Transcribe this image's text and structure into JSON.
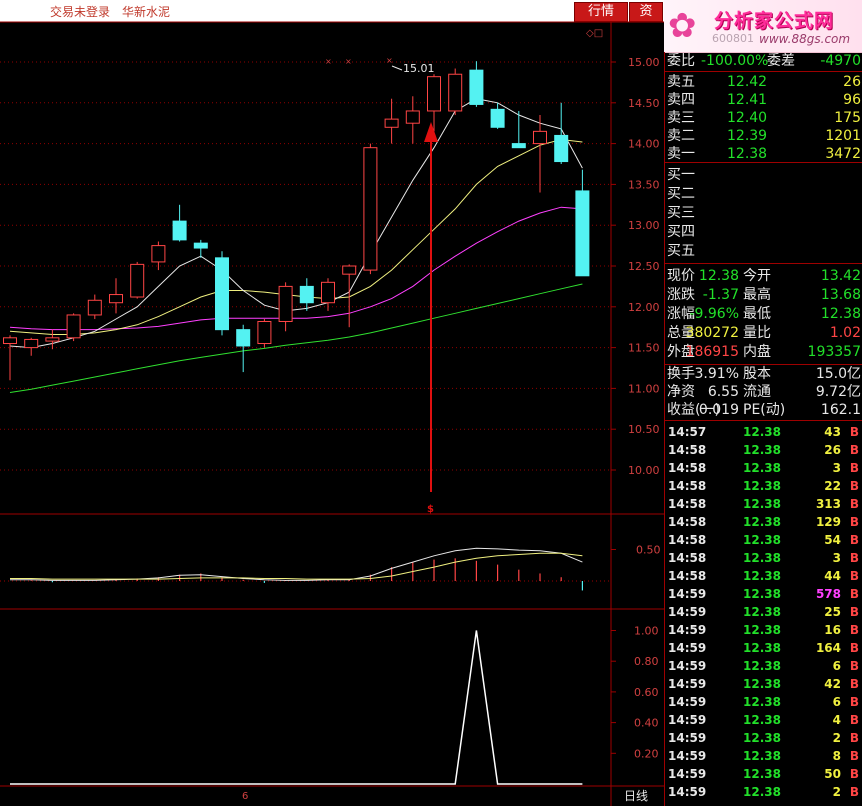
{
  "header": {
    "trade_status": "交易未登录",
    "stock_name": "华新水泥",
    "tab_quote": "行情",
    "tab_info": "资",
    "logo_title": "分析家公式网",
    "logo_url": "www.88gs.com",
    "logo_ghost": "600801"
  },
  "colors": {
    "up": "#ff4545",
    "down": "#54f2f2",
    "ma5": "#e8e8e8",
    "ma10": "#f0f080",
    "ma20": "#ff40ff",
    "ma60": "#30e030",
    "grid": "#9e0000"
  },
  "main_chart": {
    "price_axis": [
      "15.00",
      "14.50",
      "14.00",
      "13.50",
      "13.00",
      "12.50",
      "12.00",
      "11.50",
      "11.00",
      "10.50",
      "10.00"
    ],
    "high_label": "15.01",
    "signal_marker": "$",
    "marker_symbol": "◇□"
  },
  "sub_chart1": {
    "axis": [
      "0.50"
    ]
  },
  "sub_chart2": {
    "axis": [
      "1.00",
      "0.80",
      "0.60",
      "0.40",
      "0.20"
    ]
  },
  "bottom": {
    "period_label": "日线",
    "date_tick": "6"
  },
  "chart_data": [
    {
      "type": "candlestick",
      "title": "",
      "ylim": [
        9.6,
        15.15
      ],
      "candles": [
        [
          11.55,
          11.65,
          11.1,
          11.62
        ],
        [
          11.5,
          11.62,
          11.4,
          11.6
        ],
        [
          11.58,
          11.72,
          11.48,
          11.62
        ],
        [
          11.62,
          11.92,
          11.58,
          11.9
        ],
        [
          11.9,
          12.15,
          11.85,
          12.08
        ],
        [
          12.05,
          12.35,
          11.92,
          12.15
        ],
        [
          12.12,
          12.55,
          12.1,
          12.52
        ],
        [
          12.55,
          12.8,
          12.45,
          12.75
        ],
        [
          13.05,
          13.25,
          12.8,
          12.82
        ],
        [
          12.78,
          12.82,
          12.6,
          12.72
        ],
        [
          12.6,
          12.68,
          11.65,
          11.72
        ],
        [
          11.72,
          11.78,
          11.2,
          11.52
        ],
        [
          11.55,
          11.85,
          11.5,
          11.82
        ],
        [
          11.82,
          12.3,
          11.7,
          12.25
        ],
        [
          12.25,
          12.35,
          11.95,
          12.05
        ],
        [
          12.05,
          12.35,
          11.95,
          12.3
        ],
        [
          12.4,
          12.52,
          11.75,
          12.5
        ],
        [
          12.45,
          14.0,
          12.4,
          13.95
        ],
        [
          14.2,
          14.55,
          14.0,
          14.3
        ],
        [
          14.25,
          14.58,
          14.0,
          14.4
        ],
        [
          14.4,
          14.85,
          14.15,
          14.82
        ],
        [
          14.4,
          14.92,
          14.35,
          14.85
        ],
        [
          14.9,
          15.01,
          14.45,
          14.48
        ],
        [
          14.42,
          14.5,
          14.18,
          14.2
        ],
        [
          14.0,
          14.4,
          13.95,
          13.95
        ],
        [
          14.0,
          14.35,
          13.4,
          14.15
        ],
        [
          14.1,
          14.5,
          13.75,
          13.78
        ],
        [
          13.42,
          13.68,
          12.38,
          12.38
        ]
      ],
      "ma5": [
        11.52,
        11.5,
        11.55,
        11.62,
        11.7,
        11.85,
        12.0,
        12.25,
        12.5,
        12.62,
        12.45,
        12.2,
        12.02,
        11.95,
        11.98,
        12.05,
        12.18,
        12.65,
        13.1,
        13.55,
        13.95,
        14.4,
        14.55,
        14.5,
        14.35,
        14.25,
        14.18,
        13.7
      ],
      "ma10": [
        11.7,
        11.68,
        11.66,
        11.66,
        11.68,
        11.72,
        11.78,
        11.88,
        12.0,
        12.12,
        12.2,
        12.2,
        12.18,
        12.15,
        12.12,
        12.1,
        12.12,
        12.25,
        12.45,
        12.7,
        12.95,
        13.2,
        13.5,
        13.72,
        13.85,
        13.98,
        14.05,
        14.02
      ],
      "ma20": [
        11.75,
        11.73,
        11.72,
        11.72,
        11.72,
        11.73,
        11.74,
        11.76,
        11.8,
        11.84,
        11.86,
        11.86,
        11.86,
        11.86,
        11.86,
        11.88,
        11.92,
        12.0,
        12.1,
        12.25,
        12.45,
        12.62,
        12.78,
        12.92,
        13.05,
        13.15,
        13.22,
        13.2
      ],
      "ma60": [
        10.95,
        10.99,
        11.04,
        11.09,
        11.14,
        11.19,
        11.24,
        11.29,
        11.34,
        11.38,
        11.42,
        11.46,
        11.49,
        11.53,
        11.56,
        11.59,
        11.63,
        11.68,
        11.74,
        11.8,
        11.86,
        11.92,
        11.98,
        12.04,
        12.1,
        12.16,
        12.22,
        12.28
      ]
    },
    {
      "type": "line",
      "title": "",
      "ylim": [
        -0.15,
        0.95
      ],
      "series": [
        {
          "values": [
            0.02,
            0.02,
            0.01,
            0.01,
            0.01,
            0.02,
            0.03,
            0.05,
            0.09,
            0.1,
            0.07,
            0.04,
            0.02,
            0.01,
            0.01,
            0.02,
            0.02,
            0.08,
            0.2,
            0.3,
            0.4,
            0.48,
            0.52,
            0.51,
            0.49,
            0.48,
            0.44,
            0.3
          ]
        },
        {
          "values": [
            0.04,
            0.04,
            0.03,
            0.03,
            0.03,
            0.03,
            0.03,
            0.03,
            0.04,
            0.05,
            0.05,
            0.05,
            0.04,
            0.04,
            0.03,
            0.03,
            0.03,
            0.04,
            0.08,
            0.15,
            0.22,
            0.3,
            0.36,
            0.4,
            0.42,
            0.44,
            0.44,
            0.4
          ]
        }
      ],
      "bars": [
        0.0,
        0.01,
        -0.02,
        0.0,
        0.0,
        0.03,
        0.04,
        0.06,
        0.1,
        0.12,
        0.06,
        0.02,
        -0.03,
        0.01,
        0.0,
        0.03,
        0.03,
        0.1,
        0.22,
        0.3,
        0.34,
        0.36,
        0.32,
        0.26,
        0.18,
        0.12,
        0.06,
        -0.15
      ]
    },
    {
      "type": "line",
      "title": "",
      "ylim": [
        0,
        1.08
      ],
      "series": [
        {
          "values": [
            0,
            0,
            0,
            0,
            0,
            0,
            0,
            0,
            0,
            0,
            0,
            0,
            0,
            0,
            0,
            0,
            0,
            0,
            0,
            0,
            0,
            0,
            1,
            0,
            0,
            0,
            0,
            0
          ]
        }
      ]
    }
  ],
  "quote": {
    "ratio_label": "委比",
    "ratio_value": "-100.00%",
    "diff_label": "委差",
    "diff_value": "-4970",
    "asks": [
      {
        "label": "卖五",
        "price": "12.42",
        "vol": "26"
      },
      {
        "label": "卖四",
        "price": "12.41",
        "vol": "96"
      },
      {
        "label": "卖三",
        "price": "12.40",
        "vol": "175"
      },
      {
        "label": "卖二",
        "price": "12.39",
        "vol": "1201"
      },
      {
        "label": "卖一",
        "price": "12.38",
        "vol": "3472"
      }
    ],
    "bids": [
      {
        "label": "买一"
      },
      {
        "label": "买二"
      },
      {
        "label": "买三"
      },
      {
        "label": "买四"
      },
      {
        "label": "买五"
      }
    ],
    "stats": [
      {
        "l1": "现价",
        "v1": "12.38",
        "c1": "green",
        "l2": "今开",
        "v2": "13.42",
        "c2": "green"
      },
      {
        "l1": "涨跌",
        "v1": "-1.37",
        "c1": "green",
        "l2": "最高",
        "v2": "13.68",
        "c2": "green"
      },
      {
        "l1": "涨幅",
        "v1": "-9.96%",
        "c1": "green",
        "l2": "最低",
        "v2": "12.38",
        "c2": "green"
      },
      {
        "l1": "总量",
        "v1": "380272",
        "c1": "yellow",
        "l2": "量比",
        "v2": "1.02",
        "c2": "red"
      },
      {
        "l1": "外盘",
        "v1": "186915",
        "c1": "red",
        "l2": "内盘",
        "v2": "193357",
        "c2": "green"
      }
    ],
    "fundamentals": [
      {
        "l1": "换手",
        "v1": "3.91%",
        "l2": "股本",
        "v2": "15.0亿"
      },
      {
        "l1": "净资",
        "v1": "6.55",
        "l2": "流通",
        "v2": "9.72亿"
      },
      {
        "l1": "收益(一)",
        "v1": "0.019",
        "l2": "PE(动)",
        "v2": "162.1"
      }
    ]
  },
  "ticks": [
    {
      "time": "14:57",
      "price": "12.38",
      "vol": "43",
      "vc": "yellow",
      "dir": "B"
    },
    {
      "time": "14:58",
      "price": "12.38",
      "vol": "26",
      "vc": "yellow",
      "dir": "B"
    },
    {
      "time": "14:58",
      "price": "12.38",
      "vol": "3",
      "vc": "yellow",
      "dir": "B"
    },
    {
      "time": "14:58",
      "price": "12.38",
      "vol": "22",
      "vc": "yellow",
      "dir": "B"
    },
    {
      "time": "14:58",
      "price": "12.38",
      "vol": "313",
      "vc": "yellow",
      "dir": "B"
    },
    {
      "time": "14:58",
      "price": "12.38",
      "vol": "129",
      "vc": "yellow",
      "dir": "B"
    },
    {
      "time": "14:58",
      "price": "12.38",
      "vol": "54",
      "vc": "yellow",
      "dir": "B"
    },
    {
      "time": "14:58",
      "price": "12.38",
      "vol": "3",
      "vc": "yellow",
      "dir": "B"
    },
    {
      "time": "14:58",
      "price": "12.38",
      "vol": "44",
      "vc": "yellow",
      "dir": "B"
    },
    {
      "time": "14:59",
      "price": "12.38",
      "vol": "578",
      "vc": "purple",
      "dir": "B"
    },
    {
      "time": "14:59",
      "price": "12.38",
      "vol": "25",
      "vc": "yellow",
      "dir": "B"
    },
    {
      "time": "14:59",
      "price": "12.38",
      "vol": "16",
      "vc": "yellow",
      "dir": "B"
    },
    {
      "time": "14:59",
      "price": "12.38",
      "vol": "164",
      "vc": "yellow",
      "dir": "B"
    },
    {
      "time": "14:59",
      "price": "12.38",
      "vol": "6",
      "vc": "yellow",
      "dir": "B"
    },
    {
      "time": "14:59",
      "price": "12.38",
      "vol": "42",
      "vc": "yellow",
      "dir": "B"
    },
    {
      "time": "14:59",
      "price": "12.38",
      "vol": "6",
      "vc": "yellow",
      "dir": "B"
    },
    {
      "time": "14:59",
      "price": "12.38",
      "vol": "4",
      "vc": "yellow",
      "dir": "B"
    },
    {
      "time": "14:59",
      "price": "12.38",
      "vol": "2",
      "vc": "yellow",
      "dir": "B"
    },
    {
      "time": "14:59",
      "price": "12.38",
      "vol": "8",
      "vc": "yellow",
      "dir": "B"
    },
    {
      "time": "14:59",
      "price": "12.38",
      "vol": "50",
      "vc": "yellow",
      "dir": "B"
    },
    {
      "time": "14:59",
      "price": "12.38",
      "vol": "2",
      "vc": "yellow",
      "dir": "B"
    }
  ]
}
